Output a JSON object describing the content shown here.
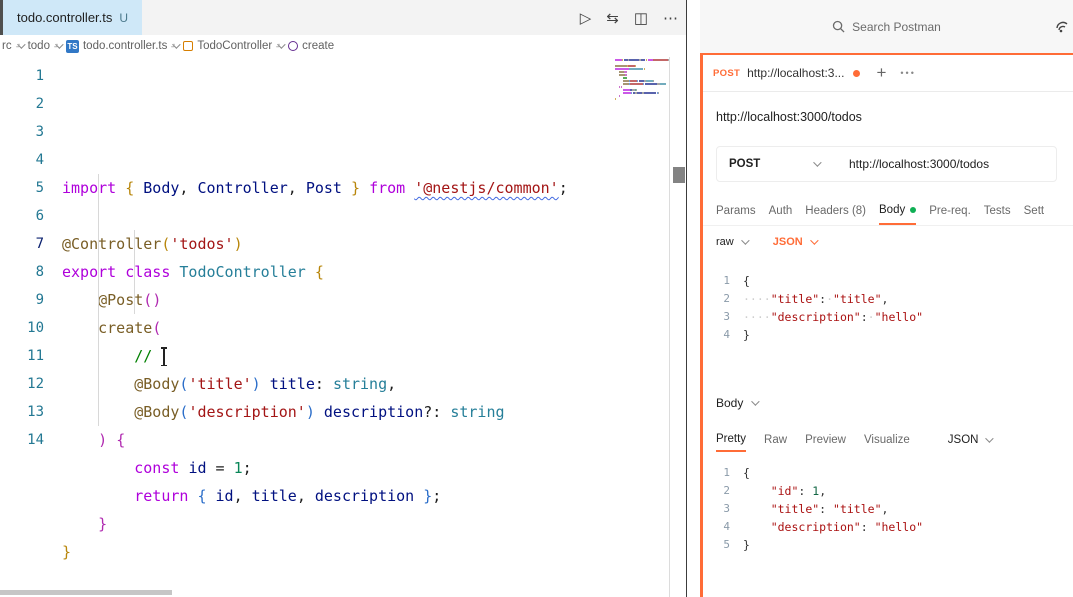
{
  "colors": {
    "accent_orange": "#ff6c37",
    "body_dot_green": "#0faf54",
    "ts_badge_blue": "#3178c6"
  },
  "icons": {
    "chevron_right": "›"
  },
  "vscode": {
    "tab": {
      "filename": "todo.controller.ts",
      "git_status": "U"
    },
    "toolbar": {
      "run_icon": "▷",
      "open_changes_icon": "⇆",
      "split_editor_icon": "◫",
      "more_actions_icon": "⋯"
    },
    "breadcrumb": {
      "crumb1": "rc",
      "crumb2": "todo",
      "file_badge": "TS",
      "file": "todo.controller.ts",
      "symbol_class": "TodoController",
      "symbol_method": "create"
    },
    "editor": {
      "active_line": 7,
      "lines": [
        [
          [
            "kw",
            "import "
          ],
          [
            "b1",
            "{"
          ],
          [
            "pl",
            " "
          ],
          [
            "var",
            "Body"
          ],
          [
            "pu",
            ", "
          ],
          [
            "var",
            "Controller"
          ],
          [
            "pu",
            ", "
          ],
          [
            "var",
            "Post"
          ],
          [
            "pl",
            " "
          ],
          [
            "b1",
            "}"
          ],
          [
            "pl",
            " "
          ],
          [
            "kw",
            "from "
          ],
          [
            "strq",
            "'@nestjs/common'"
          ],
          [
            "pu",
            ";"
          ]
        ],
        [],
        [
          [
            "fn",
            "@Controller"
          ],
          [
            "b1",
            "("
          ],
          [
            "str",
            "'todos'"
          ],
          [
            "b1",
            ")"
          ]
        ],
        [
          [
            "kw",
            "export class "
          ],
          [
            "typ",
            "TodoController"
          ],
          [
            "pl",
            " "
          ],
          [
            "b1",
            "{"
          ]
        ],
        [
          [
            "pl",
            "    "
          ],
          [
            "fn",
            "@Post"
          ],
          [
            "b2",
            "("
          ],
          [
            "b2",
            ")"
          ]
        ],
        [
          [
            "pl",
            "    "
          ],
          [
            "fn",
            "create"
          ],
          [
            "b2",
            "("
          ]
        ],
        [
          [
            "pl",
            "        "
          ],
          [
            "cmt",
            "// "
          ],
          [
            "caret",
            ""
          ]
        ],
        [
          [
            "pl",
            "        "
          ],
          [
            "fn",
            "@Body"
          ],
          [
            "b3",
            "("
          ],
          [
            "str",
            "'title'"
          ],
          [
            "b3",
            ")"
          ],
          [
            "pl",
            " "
          ],
          [
            "var",
            "title"
          ],
          [
            "pu",
            ": "
          ],
          [
            "typ",
            "string"
          ],
          [
            "pu",
            ","
          ]
        ],
        [
          [
            "pl",
            "        "
          ],
          [
            "fn",
            "@Body"
          ],
          [
            "b3",
            "("
          ],
          [
            "str",
            "'description'"
          ],
          [
            "b3",
            ")"
          ],
          [
            "pl",
            " "
          ],
          [
            "var",
            "description"
          ],
          [
            "pu",
            "?: "
          ],
          [
            "typ",
            "string"
          ]
        ],
        [
          [
            "pl",
            "    "
          ],
          [
            "b2",
            ")"
          ],
          [
            "pl",
            " "
          ],
          [
            "b2",
            "{"
          ]
        ],
        [
          [
            "pl",
            "        "
          ],
          [
            "kw",
            "const "
          ],
          [
            "var",
            "id"
          ],
          [
            "pu",
            " = "
          ],
          [
            "num",
            "1"
          ],
          [
            "pu",
            ";"
          ]
        ],
        [
          [
            "pl",
            "        "
          ],
          [
            "kw",
            "return "
          ],
          [
            "b3",
            "{"
          ],
          [
            "pl",
            " "
          ],
          [
            "var",
            "id"
          ],
          [
            "pu",
            ", "
          ],
          [
            "var",
            "title"
          ],
          [
            "pu",
            ", "
          ],
          [
            "var",
            "description"
          ],
          [
            "pl",
            " "
          ],
          [
            "b3",
            "}"
          ],
          [
            "pu",
            ";"
          ]
        ],
        [
          [
            "pl",
            "    "
          ],
          [
            "b2",
            "}"
          ]
        ],
        [
          [
            "b1",
            "}"
          ]
        ]
      ]
    }
  },
  "postman": {
    "header": {
      "search_placeholder": "Search Postman"
    },
    "tabbar": {
      "method": "POST",
      "title": "http://localhost:3...",
      "new_tab": "+",
      "more_options": "•••"
    },
    "request_name": "http://localhost:3000/todos",
    "request_bar": {
      "method": "POST",
      "url": "http://localhost:3000/todos"
    },
    "request_tabs": [
      {
        "label": "Params"
      },
      {
        "label": "Auth"
      },
      {
        "label": "Headers (8)"
      },
      {
        "label": "Body"
      },
      {
        "label": "Pre-req."
      },
      {
        "label": "Tests"
      },
      {
        "label": "Sett"
      }
    ],
    "active_request_tab": "Body",
    "body_controls": {
      "type": "raw",
      "format": "JSON"
    },
    "request_body": {
      "lines": [
        [
          [
            "pm-p",
            "{"
          ]
        ],
        [
          [
            "pm-ws",
            "····"
          ],
          [
            "pm-s",
            "\"title\""
          ],
          [
            "pm-p",
            ":"
          ],
          [
            "pm-ws",
            "·"
          ],
          [
            "pm-s",
            "\"title\""
          ],
          [
            "pm-p",
            ","
          ]
        ],
        [
          [
            "pm-ws",
            "····"
          ],
          [
            "pm-s",
            "\"description\""
          ],
          [
            "pm-p",
            ":"
          ],
          [
            "pm-ws",
            "·"
          ],
          [
            "pm-s",
            "\"hello\""
          ]
        ],
        [
          [
            "pm-p",
            "}"
          ]
        ]
      ]
    },
    "response": {
      "section_label": "Body",
      "tabs": [
        {
          "label": "Pretty"
        },
        {
          "label": "Raw"
        },
        {
          "label": "Preview"
        },
        {
          "label": "Visualize"
        }
      ],
      "active_tab": "Pretty",
      "format": "JSON",
      "lines": [
        [
          [
            "pm-p",
            "{"
          ]
        ],
        [
          [
            "pm-pl",
            "    "
          ],
          [
            "pm-s",
            "\"id\""
          ],
          [
            "pm-p",
            ": "
          ],
          [
            "pm-n",
            "1"
          ],
          [
            "pm-p",
            ","
          ]
        ],
        [
          [
            "pm-pl",
            "    "
          ],
          [
            "pm-s",
            "\"title\""
          ],
          [
            "pm-p",
            ": "
          ],
          [
            "pm-s",
            "\"title\""
          ],
          [
            "pm-p",
            ","
          ]
        ],
        [
          [
            "pm-pl",
            "    "
          ],
          [
            "pm-s",
            "\"description\""
          ],
          [
            "pm-p",
            ": "
          ],
          [
            "pm-s",
            "\"hello\""
          ]
        ],
        [
          [
            "pm-p",
            "}"
          ]
        ]
      ]
    }
  }
}
